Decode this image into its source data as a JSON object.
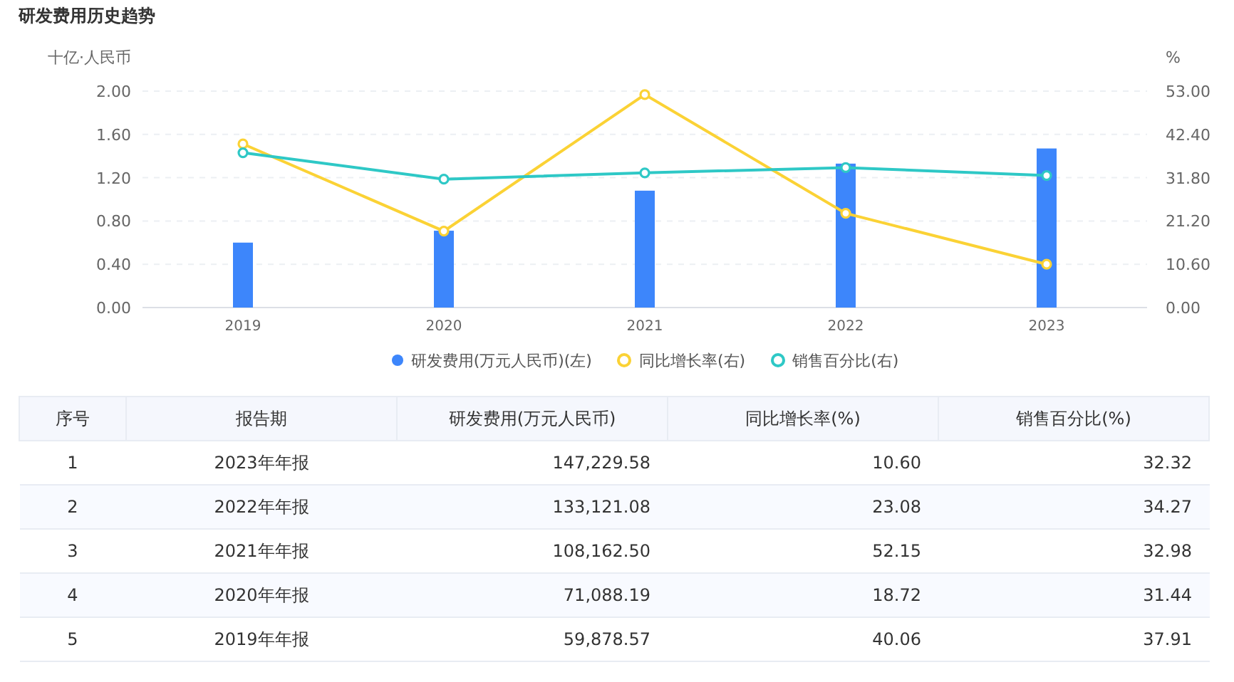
{
  "title": "研发费用历史趋势",
  "chart": {
    "layers": [
      {
        "chart_data": {
          "type": "bar",
          "ylabel": "十亿·人民币",
          "categories": [
            "2019",
            "2020",
            "2021",
            "2022",
            "2023"
          ],
          "ylim": [
            0,
            2
          ],
          "grid": true,
          "yticks": [
            {
              "value": 0,
              "label": "0.00"
            },
            {
              "value": 0.4,
              "label": "0.40"
            },
            {
              "value": 0.8,
              "label": "0.80"
            },
            {
              "value": 1.2,
              "label": "1.20"
            },
            {
              "value": 1.6,
              "label": "1.60"
            },
            {
              "value": 2,
              "label": "2.00"
            }
          ],
          "series": [
            {
              "name": "研发费用(万元人民币)(左)",
              "color": "#3d86fb",
              "values": [
                0.6,
                0.71,
                1.08,
                1.33,
                1.47
              ]
            }
          ]
        }
      },
      {
        "chart_data": {
          "type": "line",
          "ylabel": "%",
          "ylim": [
            0,
            53
          ],
          "yticks": [
            {
              "value": 0,
              "label": "0.00"
            },
            {
              "value": 10.6,
              "label": "10.60"
            },
            {
              "value": 21.2,
              "label": "21.20"
            },
            {
              "value": 31.8,
              "label": "31.80"
            },
            {
              "value": 42.4,
              "label": "42.40"
            },
            {
              "value": 53,
              "label": "53.00"
            }
          ],
          "series": [
            {
              "name": "同比增长率(右)",
              "color": "#fbd235",
              "marker": "circle",
              "values": [
                40.06,
                18.72,
                52.15,
                23.08,
                10.6
              ]
            },
            {
              "name": "销售百分比(右)",
              "color": "#2ec8c6",
              "marker": "circle",
              "values": [
                37.91,
                31.44,
                32.98,
                34.27,
                32.32
              ]
            }
          ]
        }
      }
    ]
  },
  "table": {
    "columns": [
      "序号",
      "报告期",
      "研发费用(万元人民币)",
      "同比增长率(%)",
      "销售百分比(%)"
    ],
    "rows": [
      [
        "1",
        "2023年年报",
        "147,229.58",
        "10.60",
        "32.32"
      ],
      [
        "2",
        "2022年年报",
        "133,121.08",
        "23.08",
        "34.27"
      ],
      [
        "3",
        "2021年年报",
        "108,162.50",
        "52.15",
        "32.98"
      ],
      [
        "4",
        "2020年年报",
        "71,088.19",
        "18.72",
        "31.44"
      ],
      [
        "5",
        "2019年年报",
        "59,878.57",
        "40.06",
        "37.91"
      ]
    ]
  }
}
